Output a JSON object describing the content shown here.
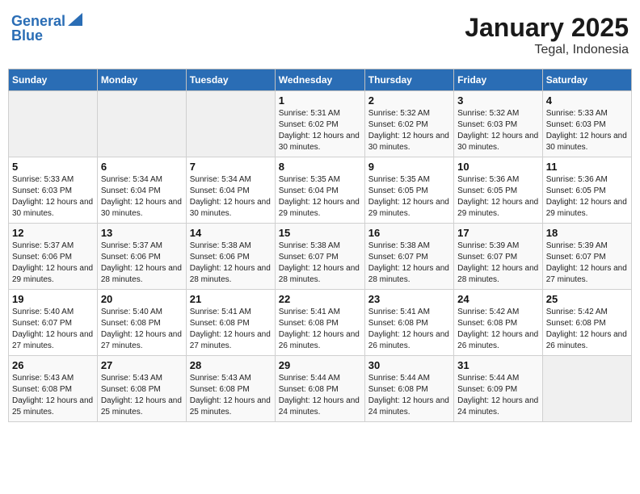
{
  "header": {
    "logo_line1": "General",
    "logo_line2": "Blue",
    "title": "January 2025",
    "subtitle": "Tegal, Indonesia"
  },
  "days_of_week": [
    "Sunday",
    "Monday",
    "Tuesday",
    "Wednesday",
    "Thursday",
    "Friday",
    "Saturday"
  ],
  "weeks": [
    {
      "days": [
        {
          "num": "",
          "info": ""
        },
        {
          "num": "",
          "info": ""
        },
        {
          "num": "",
          "info": ""
        },
        {
          "num": "1",
          "info": "Sunrise: 5:31 AM\nSunset: 6:02 PM\nDaylight: 12 hours and 30 minutes."
        },
        {
          "num": "2",
          "info": "Sunrise: 5:32 AM\nSunset: 6:02 PM\nDaylight: 12 hours and 30 minutes."
        },
        {
          "num": "3",
          "info": "Sunrise: 5:32 AM\nSunset: 6:03 PM\nDaylight: 12 hours and 30 minutes."
        },
        {
          "num": "4",
          "info": "Sunrise: 5:33 AM\nSunset: 6:03 PM\nDaylight: 12 hours and 30 minutes."
        }
      ]
    },
    {
      "days": [
        {
          "num": "5",
          "info": "Sunrise: 5:33 AM\nSunset: 6:03 PM\nDaylight: 12 hours and 30 minutes."
        },
        {
          "num": "6",
          "info": "Sunrise: 5:34 AM\nSunset: 6:04 PM\nDaylight: 12 hours and 30 minutes."
        },
        {
          "num": "7",
          "info": "Sunrise: 5:34 AM\nSunset: 6:04 PM\nDaylight: 12 hours and 30 minutes."
        },
        {
          "num": "8",
          "info": "Sunrise: 5:35 AM\nSunset: 6:04 PM\nDaylight: 12 hours and 29 minutes."
        },
        {
          "num": "9",
          "info": "Sunrise: 5:35 AM\nSunset: 6:05 PM\nDaylight: 12 hours and 29 minutes."
        },
        {
          "num": "10",
          "info": "Sunrise: 5:36 AM\nSunset: 6:05 PM\nDaylight: 12 hours and 29 minutes."
        },
        {
          "num": "11",
          "info": "Sunrise: 5:36 AM\nSunset: 6:05 PM\nDaylight: 12 hours and 29 minutes."
        }
      ]
    },
    {
      "days": [
        {
          "num": "12",
          "info": "Sunrise: 5:37 AM\nSunset: 6:06 PM\nDaylight: 12 hours and 29 minutes."
        },
        {
          "num": "13",
          "info": "Sunrise: 5:37 AM\nSunset: 6:06 PM\nDaylight: 12 hours and 28 minutes."
        },
        {
          "num": "14",
          "info": "Sunrise: 5:38 AM\nSunset: 6:06 PM\nDaylight: 12 hours and 28 minutes."
        },
        {
          "num": "15",
          "info": "Sunrise: 5:38 AM\nSunset: 6:07 PM\nDaylight: 12 hours and 28 minutes."
        },
        {
          "num": "16",
          "info": "Sunrise: 5:38 AM\nSunset: 6:07 PM\nDaylight: 12 hours and 28 minutes."
        },
        {
          "num": "17",
          "info": "Sunrise: 5:39 AM\nSunset: 6:07 PM\nDaylight: 12 hours and 28 minutes."
        },
        {
          "num": "18",
          "info": "Sunrise: 5:39 AM\nSunset: 6:07 PM\nDaylight: 12 hours and 27 minutes."
        }
      ]
    },
    {
      "days": [
        {
          "num": "19",
          "info": "Sunrise: 5:40 AM\nSunset: 6:07 PM\nDaylight: 12 hours and 27 minutes."
        },
        {
          "num": "20",
          "info": "Sunrise: 5:40 AM\nSunset: 6:08 PM\nDaylight: 12 hours and 27 minutes."
        },
        {
          "num": "21",
          "info": "Sunrise: 5:41 AM\nSunset: 6:08 PM\nDaylight: 12 hours and 27 minutes."
        },
        {
          "num": "22",
          "info": "Sunrise: 5:41 AM\nSunset: 6:08 PM\nDaylight: 12 hours and 26 minutes."
        },
        {
          "num": "23",
          "info": "Sunrise: 5:41 AM\nSunset: 6:08 PM\nDaylight: 12 hours and 26 minutes."
        },
        {
          "num": "24",
          "info": "Sunrise: 5:42 AM\nSunset: 6:08 PM\nDaylight: 12 hours and 26 minutes."
        },
        {
          "num": "25",
          "info": "Sunrise: 5:42 AM\nSunset: 6:08 PM\nDaylight: 12 hours and 26 minutes."
        }
      ]
    },
    {
      "days": [
        {
          "num": "26",
          "info": "Sunrise: 5:43 AM\nSunset: 6:08 PM\nDaylight: 12 hours and 25 minutes."
        },
        {
          "num": "27",
          "info": "Sunrise: 5:43 AM\nSunset: 6:08 PM\nDaylight: 12 hours and 25 minutes."
        },
        {
          "num": "28",
          "info": "Sunrise: 5:43 AM\nSunset: 6:08 PM\nDaylight: 12 hours and 25 minutes."
        },
        {
          "num": "29",
          "info": "Sunrise: 5:44 AM\nSunset: 6:08 PM\nDaylight: 12 hours and 24 minutes."
        },
        {
          "num": "30",
          "info": "Sunrise: 5:44 AM\nSunset: 6:08 PM\nDaylight: 12 hours and 24 minutes."
        },
        {
          "num": "31",
          "info": "Sunrise: 5:44 AM\nSunset: 6:09 PM\nDaylight: 12 hours and 24 minutes."
        },
        {
          "num": "",
          "info": ""
        }
      ]
    }
  ]
}
